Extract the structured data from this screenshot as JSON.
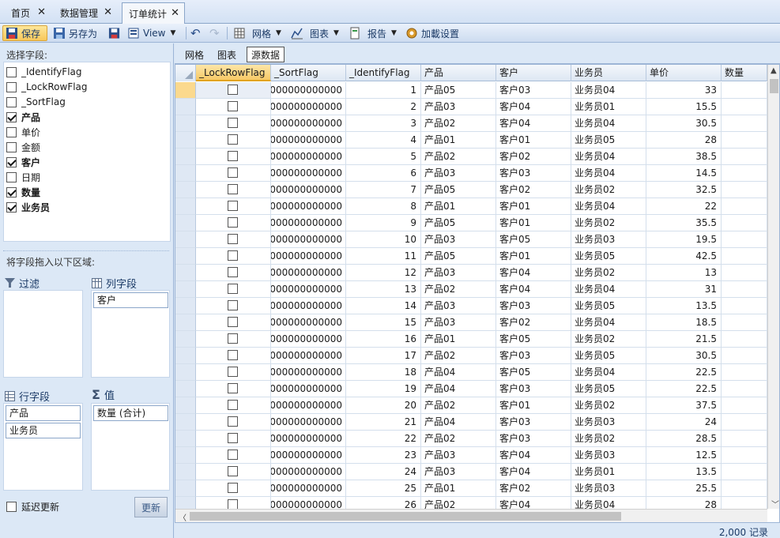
{
  "doc_tabs": [
    {
      "label": "首页",
      "active": false
    },
    {
      "label": "数据管理",
      "active": false
    },
    {
      "label": "订单统计",
      "active": true
    }
  ],
  "toolbar": {
    "save": "保存",
    "save_as": "另存为",
    "view": "View",
    "grid": "网格",
    "chart": "图表",
    "report": "报告",
    "load_settings": "加載设置"
  },
  "field_panel": {
    "title": "选择字段:",
    "fields": [
      {
        "label": "_IdentifyFlag",
        "checked": false
      },
      {
        "label": "_LockRowFlag",
        "checked": false
      },
      {
        "label": "_SortFlag",
        "checked": false
      },
      {
        "label": "产品",
        "checked": true
      },
      {
        "label": "单价",
        "checked": false
      },
      {
        "label": "金额",
        "checked": false
      },
      {
        "label": "客户",
        "checked": true
      },
      {
        "label": "日期",
        "checked": false
      },
      {
        "label": "数量",
        "checked": true
      },
      {
        "label": "业务员",
        "checked": true
      }
    ],
    "drag_hint": "将字段拖入以下区域:",
    "filter_title": "过滤",
    "column_title": "列字段",
    "column_items": [
      "客户"
    ],
    "row_title": "行字段",
    "row_items": [
      "产品",
      "业务员"
    ],
    "value_title": "值",
    "value_items": [
      "数量 (合计)"
    ],
    "defer_update": "延迟更新",
    "defer_checked": false,
    "update_button": "更新"
  },
  "view_tabs": [
    {
      "label": "网格",
      "active": false
    },
    {
      "label": "图表",
      "active": false
    },
    {
      "label": "源数据",
      "active": true
    }
  ],
  "grid": {
    "columns": [
      "_LockRowFlag",
      "_SortFlag",
      "_IdentifyFlag",
      "产品",
      "客户",
      "业务员",
      "单价",
      "数量"
    ],
    "sorted_column": "_LockRowFlag",
    "rows": [
      [
        "",
        "0000000000000",
        "1",
        "产品05",
        "客户03",
        "业务员04",
        "33",
        ""
      ],
      [
        "",
        "0000000000000",
        "2",
        "产品03",
        "客户04",
        "业务员01",
        "15.5",
        ""
      ],
      [
        "",
        "0000000000000",
        "3",
        "产品02",
        "客户04",
        "业务员04",
        "30.5",
        ""
      ],
      [
        "",
        "0000000000000",
        "4",
        "产品01",
        "客户01",
        "业务员05",
        "28",
        ""
      ],
      [
        "",
        "0000000000000",
        "5",
        "产品02",
        "客户02",
        "业务员04",
        "38.5",
        ""
      ],
      [
        "",
        "0000000000000",
        "6",
        "产品03",
        "客户03",
        "业务员04",
        "14.5",
        ""
      ],
      [
        "",
        "0000000000000",
        "7",
        "产品05",
        "客户02",
        "业务员02",
        "32.5",
        ""
      ],
      [
        "",
        "0000000000000",
        "8",
        "产品01",
        "客户01",
        "业务员04",
        "22",
        ""
      ],
      [
        "",
        "0000000000000",
        "9",
        "产品05",
        "客户01",
        "业务员02",
        "35.5",
        ""
      ],
      [
        "",
        "0000000000000",
        "10",
        "产品03",
        "客户05",
        "业务员03",
        "19.5",
        ""
      ],
      [
        "",
        "0000000000000",
        "11",
        "产品05",
        "客户01",
        "业务员05",
        "42.5",
        ""
      ],
      [
        "",
        "0000000000000",
        "12",
        "产品03",
        "客户04",
        "业务员02",
        "13",
        ""
      ],
      [
        "",
        "0000000000000",
        "13",
        "产品02",
        "客户04",
        "业务员04",
        "31",
        ""
      ],
      [
        "",
        "0000000000000",
        "14",
        "产品03",
        "客户03",
        "业务员05",
        "13.5",
        ""
      ],
      [
        "",
        "0000000000000",
        "15",
        "产品03",
        "客户02",
        "业务员04",
        "18.5",
        ""
      ],
      [
        "",
        "0000000000000",
        "16",
        "产品01",
        "客户05",
        "业务员02",
        "21.5",
        ""
      ],
      [
        "",
        "0000000000000",
        "17",
        "产品02",
        "客户03",
        "业务员05",
        "30.5",
        ""
      ],
      [
        "",
        "0000000000000",
        "18",
        "产品04",
        "客户05",
        "业务员04",
        "22.5",
        ""
      ],
      [
        "",
        "0000000000000",
        "19",
        "产品04",
        "客户03",
        "业务员05",
        "22.5",
        ""
      ],
      [
        "",
        "0000000000000",
        "20",
        "产品02",
        "客户01",
        "业务员02",
        "37.5",
        ""
      ],
      [
        "",
        "0000000000000",
        "21",
        "产品04",
        "客户03",
        "业务员03",
        "24",
        ""
      ],
      [
        "",
        "0000000000000",
        "22",
        "产品02",
        "客户03",
        "业务员02",
        "28.5",
        ""
      ],
      [
        "",
        "0000000000000",
        "23",
        "产品03",
        "客户04",
        "业务员03",
        "12.5",
        ""
      ],
      [
        "",
        "0000000000000",
        "24",
        "产品03",
        "客户04",
        "业务员01",
        "13.5",
        ""
      ],
      [
        "",
        "0000000000000",
        "25",
        "产品01",
        "客户02",
        "业务员03",
        "25.5",
        ""
      ],
      [
        "",
        "0000000000000",
        "26",
        "产品02",
        "客户04",
        "业务员04",
        "28",
        ""
      ]
    ]
  },
  "status": {
    "record_count": "2,000 记录"
  },
  "colors": {
    "accent": "#f8c75a",
    "panel_bg": "#dce8f6",
    "header_bg": "#dde7f3"
  }
}
